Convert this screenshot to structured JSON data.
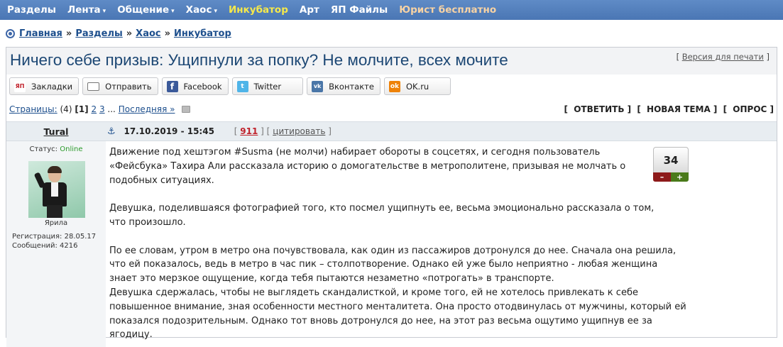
{
  "nav": {
    "items": [
      {
        "label": "Разделы",
        "caret": ""
      },
      {
        "label": "Лента",
        "caret": "▾"
      },
      {
        "label": "Общение",
        "caret": "▾"
      },
      {
        "label": "Хаос",
        "caret": "▾"
      },
      {
        "label": "Инкубатор",
        "caret": ""
      },
      {
        "label": "Арт",
        "caret": ""
      },
      {
        "label": "ЯП Файлы",
        "caret": ""
      },
      {
        "label": "Юрист бесплатно",
        "caret": ""
      }
    ],
    "colors": {
      "bar": "#4a76b4",
      "highlight": "#f6e94a",
      "accent": "#f8d3a4"
    }
  },
  "breadcrumb": {
    "items": [
      "Главная",
      "Разделы",
      "Хаос",
      "Инкубатор"
    ],
    "separator": "»"
  },
  "topic": {
    "title": "Ничего себе призыв: Ущипнули за попку? Не молчите, всех мочите",
    "print_label": "Версия для печати"
  },
  "share": {
    "buttons": [
      {
        "label": "Закладки",
        "icon": "yap-icon"
      },
      {
        "label": "Отправить",
        "icon": "envelope-icon"
      },
      {
        "label": "Facebook",
        "icon": "facebook-icon"
      },
      {
        "label": "Twitter",
        "icon": "twitter-icon"
      },
      {
        "label": "Вконтакте",
        "icon": "vk-icon"
      },
      {
        "label": "OK.ru",
        "icon": "ok-icon"
      }
    ]
  },
  "pager": {
    "label": "Страницы:",
    "count": "(4)",
    "current": "1",
    "pages": [
      "2",
      "3"
    ],
    "ellipsis": "...",
    "last_label": "Последняя »"
  },
  "actions": {
    "reply": "ОТВЕТИТЬ",
    "new_topic": "НОВАЯ ТЕМА",
    "poll": "ОПРОС"
  },
  "post": {
    "author": "Tural",
    "status_label": "Статус:",
    "status_value": "Online",
    "avatar_caption": "Ярила",
    "registration": "Регистрация: 28.05.17",
    "messages": "Сообщений: 4216",
    "date": "17.10.2019 - 15:45",
    "post_number": "911",
    "quote_label": "цитировать",
    "rating": "34",
    "rating_minus": "–",
    "rating_plus": "+",
    "paragraphs": [
      "Движение под хештэгом #Susma (не молчи) набирает обороты в соцсетях, и сегодня пользователь «Фейсбука» Тахира Али рассказала историю о домогательстве в метрополитене, призывая не молчать о подобных ситуациях.",
      "Девушка, поделившаяся фотографией того, кто посмел ущипнуть ее, весьма эмоционально рассказала о том, что произошло.",
      "По ее словам, утром в метро она почувствовала, как один из пассажиров дотронулся до нее. Сначала она решила, что ей показалось, ведь в метро в час пик – столпотворение. Однако ей уже было неприятно - любая женщина знает это мерзкое ощущение, когда тебя пытаются незаметно «потрогать» в транспорте.",
      "Девушка сдержалась, чтобы не выглядеть скандалисткой, и кроме того, ей не хотелось привлекать к себе повышенное внимание, зная особенности местного менталитета. Она просто отодвинулась от мужчины, который ей показался подозрительным. Однако тот вновь дотронулся до нее, на этот раз весьма ощутимо ущипнув ее за ягодицу."
    ]
  }
}
